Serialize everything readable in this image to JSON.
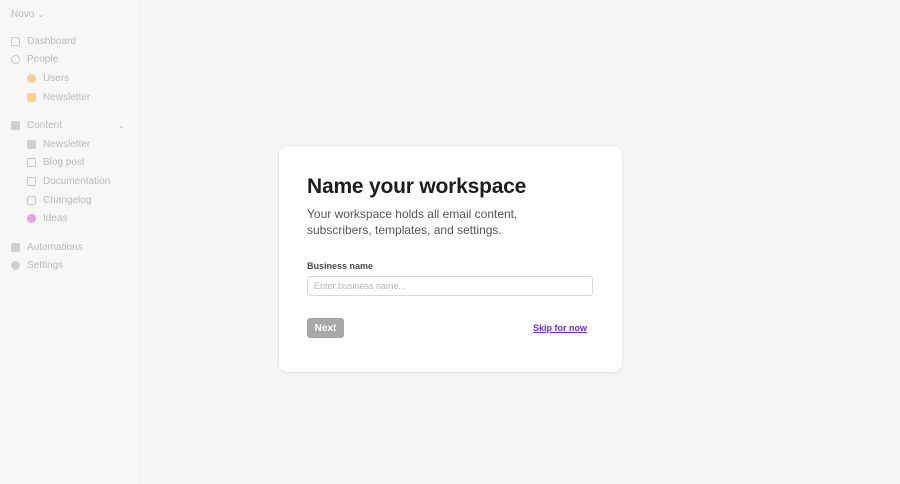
{
  "sidebar": {
    "workspace": "Novo",
    "items": [
      {
        "label": "Dashboard",
        "icon": "home-icon"
      },
      {
        "label": "People",
        "icon": "person-icon"
      },
      {
        "label": "Users",
        "icon": "users-emoji-icon"
      },
      {
        "label": "Newsletter",
        "icon": "folder-emoji-icon"
      },
      {
        "label": "Content",
        "icon": "grid-icon"
      },
      {
        "label": "Newsletter",
        "icon": "newsletter-icon"
      },
      {
        "label": "Blog post",
        "icon": "blog-icon"
      },
      {
        "label": "Documentation",
        "icon": "doc-icon"
      },
      {
        "label": "Changelog",
        "icon": "changelog-icon"
      },
      {
        "label": "Ideas",
        "icon": "ideas-icon"
      },
      {
        "label": "Automations",
        "icon": "automation-icon"
      },
      {
        "label": "Settings",
        "icon": "gear-icon"
      }
    ]
  },
  "modal": {
    "title": "Name your workspace",
    "description": "Your workspace holds all email content, subscribers, templates, and settings.",
    "field_label": "Business name",
    "field_placeholder": "Enter business name...",
    "field_value": "",
    "next_label": "Next",
    "skip_label": "Skip for now"
  },
  "colors": {
    "accent": "#6d2edb",
    "button_disabled": "#a8a8a8"
  }
}
